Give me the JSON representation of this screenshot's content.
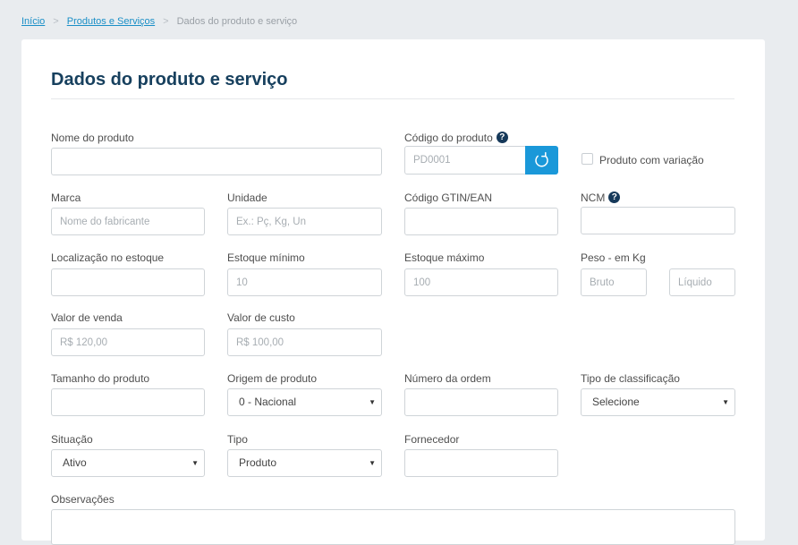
{
  "breadcrumb": {
    "home": "Início",
    "section": "Produtos e Serviços",
    "current": "Dados do produto e serviço",
    "separator": ">"
  },
  "page": {
    "title": "Dados do produto e serviço"
  },
  "form": {
    "nome_produto": {
      "label": "Nome do produto",
      "value": ""
    },
    "codigo_produto": {
      "label": "Código do produto",
      "placeholder": "PD0001"
    },
    "variacao": {
      "label": "Produto com variação",
      "checked": false
    },
    "marca": {
      "label": "Marca",
      "placeholder": "Nome do fabricante"
    },
    "unidade": {
      "label": "Unidade",
      "placeholder": "Ex.: Pç, Kg, Un"
    },
    "gtin": {
      "label": "Código GTIN/EAN",
      "value": ""
    },
    "ncm": {
      "label": "NCM",
      "value": ""
    },
    "localizacao": {
      "label": "Localização no estoque",
      "value": ""
    },
    "estoque_minimo": {
      "label": "Estoque mínimo",
      "placeholder": "10"
    },
    "estoque_maximo": {
      "label": "Estoque máximo",
      "placeholder": "100"
    },
    "peso": {
      "label": "Peso - em Kg",
      "bruto_placeholder": "Bruto",
      "liquido_placeholder": "Líquido"
    },
    "valor_venda": {
      "label": "Valor de venda",
      "placeholder": "R$ 120,00"
    },
    "valor_custo": {
      "label": "Valor de custo",
      "placeholder": "R$ 100,00"
    },
    "tamanho": {
      "label": "Tamanho do produto",
      "value": ""
    },
    "origem": {
      "label": "Origem de produto",
      "selected": "0 - Nacional"
    },
    "numero_ordem": {
      "label": "Número da ordem",
      "value": ""
    },
    "tipo_classificacao": {
      "label": "Tipo de classificação",
      "selected": "Selecione"
    },
    "situacao": {
      "label": "Situação",
      "selected": "Ativo"
    },
    "tipo": {
      "label": "Tipo",
      "selected": "Produto"
    },
    "fornecedor": {
      "label": "Fornecedor",
      "value": ""
    },
    "observacoes": {
      "label": "Observações"
    }
  },
  "icons": {
    "help": "?",
    "caret": "▼"
  },
  "colors": {
    "accent": "#1a98d9",
    "title": "#17405e",
    "link": "#1a8fc7"
  }
}
